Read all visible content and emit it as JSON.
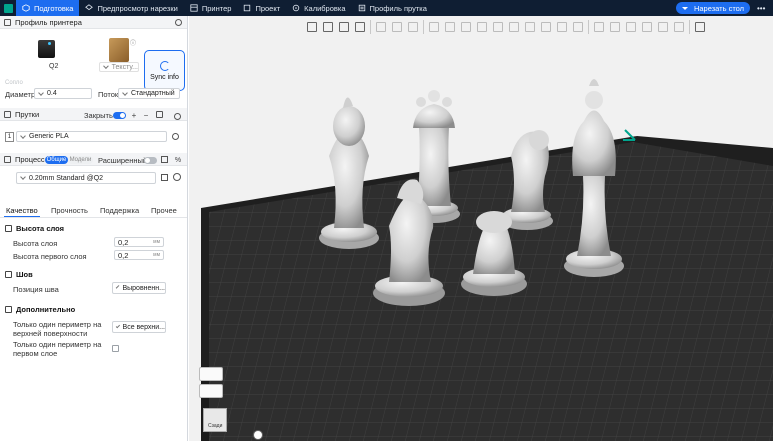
{
  "topbar": {
    "tabs": [
      {
        "label": "Подготовка",
        "active": true,
        "icon": "cube-icon"
      },
      {
        "label": "Предпросмотр нарезки",
        "active": false,
        "icon": "layers-icon"
      },
      {
        "label": "Принтер",
        "active": false,
        "icon": "printer-icon"
      },
      {
        "label": "Проект",
        "active": false,
        "icon": "project-icon"
      },
      {
        "label": "Калибровка",
        "active": false,
        "icon": "calibration-icon"
      },
      {
        "label": "Профиль прутка",
        "active": false,
        "icon": "filament-profile-icon"
      }
    ],
    "slice_button": "Нарезать стол",
    "more": "•••"
  },
  "printer": {
    "section_title": "Профиль принтера",
    "printer_name": "Q2",
    "plate_label": "Тексту...",
    "sync_label": "Sync info",
    "nozzle_hint": "Сопло",
    "diameter_label": "Диаметр",
    "diameter_value": "0.4",
    "flow_label": "Поток",
    "flow_value": "Стандартный"
  },
  "filament": {
    "section_title": "Прутки",
    "close_label": "Закрыть",
    "slot_number": "1",
    "filament_value": "Generic PLA"
  },
  "process": {
    "section_title": "Процесс",
    "pill_global": "Общие",
    "pill_objects": "Модели",
    "advanced_label": "Расширенный",
    "profile_value": "0.20mm Standard @Q2",
    "tabs": [
      "Качество",
      "Прочность",
      "Поддержка",
      "Прочее"
    ],
    "active_tab": 0
  },
  "settings": {
    "layer_height_group": "Высота слоя",
    "layer_height_label": "Высота слоя",
    "layer_height_value": "0,2",
    "first_layer_label": "Высота первого слоя",
    "first_layer_value": "0,2",
    "unit": "мм",
    "seam_group": "Шов",
    "seam_position_label": "Позиция шва",
    "seam_position_value": "Выровненн...",
    "extra_group": "Дополнительно",
    "top_perimeter_label_1": "Только один периметр на",
    "top_perimeter_label_2": "верхней поверхности",
    "top_perimeter_value": "Все верхни...",
    "first_layer_perimeter_label_1": "Только один периметр на",
    "first_layer_perimeter_label_2": "первом слое"
  },
  "viewport": {
    "nav_cube_label": "Сзади",
    "colors": {
      "bed": "#2b2b2b",
      "grid": "#4a4a4a",
      "bed_edge": "#1c1c1c",
      "accent": "#00a58e",
      "models": "#d7d7d7"
    }
  },
  "colors": {
    "topbar": "#0f1e33",
    "primary": "#1d6df0",
    "panel_header": "#f3f4f6"
  }
}
